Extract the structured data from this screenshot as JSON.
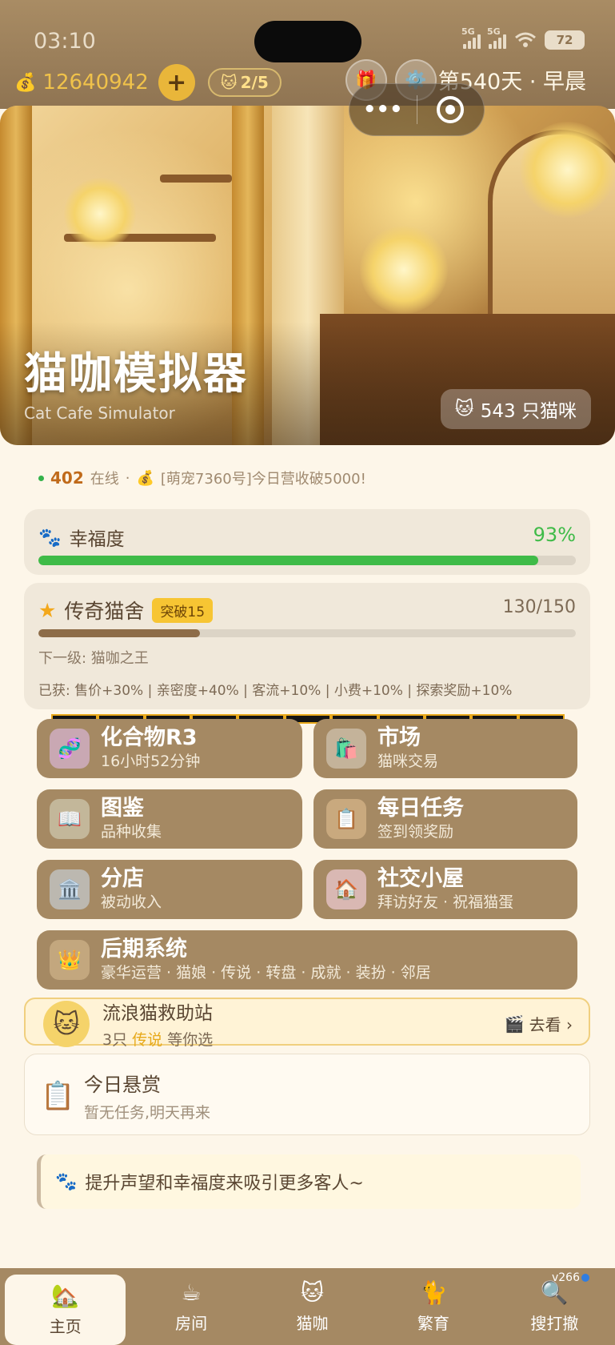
{
  "status_bar": {
    "time": "03:10",
    "signal1_label": "5G",
    "signal2_label": "5G",
    "battery": "72"
  },
  "header": {
    "coin_icon": "money-bag-icon",
    "coins": "12640942",
    "add_label": "+",
    "cat_slots": "2/5",
    "day_label": "第540天 · 早晨"
  },
  "capsule": {
    "more_label": "•••"
  },
  "hero": {
    "title": "猫咖模拟器",
    "subtitle": "Cat Cafe Simulator",
    "cat_count": "543 只猫咪"
  },
  "online": {
    "count": "402",
    "suffix": "在线",
    "separator": "·",
    "news": "[萌宠7360号]今日营收破5000!"
  },
  "happiness": {
    "label": "幸福度",
    "value": "93%",
    "fraction": 0.93
  },
  "legend": {
    "title": "传奇猫舍",
    "badge": "突破15",
    "progress": "130/150",
    "fraction": 0.3,
    "next_level": "下一级: 猫咖之王",
    "bonus": "已获: 售价+30% | 亲密度+40% | 客流+10% | 小费+10% | 探索奖励+10%"
  },
  "menu": [
    {
      "title": "化合物R3",
      "sub": "16小时52分钟",
      "icon": "dna-icon"
    },
    {
      "title": "市场",
      "sub": "猫咪交易",
      "icon": "shopping-bag-icon"
    },
    {
      "title": "图鉴",
      "sub": "品种收集",
      "icon": "book-icon"
    },
    {
      "title": "每日任务",
      "sub": "签到领奖励",
      "icon": "clipboard-icon"
    },
    {
      "title": "分店",
      "sub": "被动收入",
      "icon": "building-icon"
    },
    {
      "title": "社交小屋",
      "sub": "拜访好友 · 祝福猫蛋",
      "icon": "house-icon"
    },
    {
      "title": "后期系统",
      "sub": "豪华运营 · 猫娘 · 传说 · 转盘 · 成就 · 装扮 · 邻居",
      "icon": "crown-icon"
    }
  ],
  "rescue": {
    "title": "流浪猫救助站",
    "sub_prefix": "3只",
    "sub_highlight": "传说",
    "sub_suffix": "等你选",
    "go_label": "去看 ›"
  },
  "bounty": {
    "title": "今日悬赏",
    "sub": "暂无任务,明天再来"
  },
  "tip": "提升声望和幸福度来吸引更多客人~",
  "tabs": [
    {
      "label": "主页",
      "icon": "home-icon",
      "active": true
    },
    {
      "label": "房间",
      "icon": "coffee-cup-icon"
    },
    {
      "label": "猫咖",
      "icon": "cat-cafe-icon"
    },
    {
      "label": "繁育",
      "icon": "breeding-icon"
    },
    {
      "label": "搜打撤",
      "icon": "magnifier-icon"
    }
  ],
  "version": "v266"
}
